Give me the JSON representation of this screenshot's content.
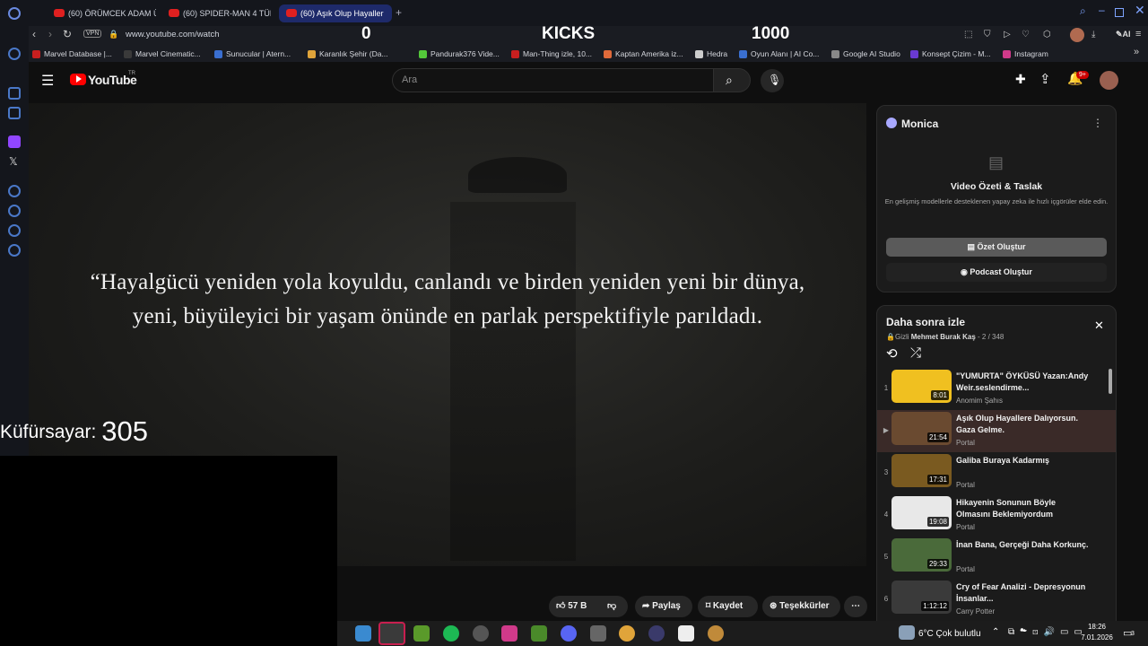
{
  "browser": {
    "tabs": [
      {
        "label": "(60) ÖRÜMCEK ADAM ÜÇ"
      },
      {
        "label": "(60) SPIDER-MAN 4 TÜM"
      },
      {
        "label": "(60) Aşık Olup Hayaller"
      }
    ],
    "url": "www.youtube.com/watch",
    "vpn": "VPN",
    "ai_label": "AI",
    "bookmarks": [
      {
        "label": "Marvel Database |...",
        "color": "#c81f1f"
      },
      {
        "label": "Marvel Cinematic...",
        "color": "#3a3a3a"
      },
      {
        "label": "Sunucular | Atern...",
        "color": "#3a6fd0"
      },
      {
        "label": "Karanlık Şehir (Da...",
        "color": "#e0a43a"
      },
      {
        "label": "Pandurak376 Vide...",
        "color": "#53c83a"
      },
      {
        "label": "Man-Thing izle, 10...",
        "color": "#c81f1f"
      },
      {
        "label": "Kaptan Amerika iz...",
        "color": "#e06a3a"
      },
      {
        "label": "Hedra",
        "color": "#cccccc"
      },
      {
        "label": "Oyun Alanı | AI Co...",
        "color": "#3a6fd0"
      },
      {
        "label": "Google AI Studio",
        "color": "#888888"
      },
      {
        "label": "Konsept Çizim - M...",
        "color": "#6a3ad0"
      },
      {
        "label": "Instagram",
        "color": "#d03a8a"
      }
    ]
  },
  "stream_overlay": {
    "left_count": "0",
    "center_label": "KICKS",
    "right_count": "1000",
    "kufur_label": "Küfürsayar:",
    "kufur_count": "305"
  },
  "youtube": {
    "logo": "YouTube",
    "region": "TR",
    "search_placeholder": "Ara",
    "notif_badge": "9+",
    "quote_line1": "“Hayalgücü yeniden yola koyuldu, canlandı ve birden yeniden yeni bir dünya,",
    "quote_line2": "yeni, büyüleyici bir yaşam önünde en parlak perspektifiyle parıldadı.",
    "actions": {
      "likes": "57 B",
      "share": "Paylaş",
      "save": "Kaydet",
      "thanks": "Teşekkürler"
    }
  },
  "monica": {
    "title": "Monica",
    "heading": "Video Özeti & Taslak",
    "description": "En gelişmiş modellerle desteklenen yapay zeka ile hızlı içgörüler elde edin.",
    "summary_button": "Özet Oluştur",
    "podcast_button": "Podcast Oluştur"
  },
  "playlist": {
    "title": "Daha sonra izle",
    "privacy": "Gizli",
    "owner": "Mehmet Burak Kaş",
    "position": "- 2 / 348",
    "items": [
      {
        "idx": "1",
        "title": "\"YUMURTA\" ÖYKÜSÜ Yazan:Andy Weir.seslendirme...",
        "channel": "Anomim Şahıs",
        "duration": "8:01",
        "thumb": "#f0c020"
      },
      {
        "idx": "▶",
        "title": "Aşık Olup Hayallere Dalıyorsun. Gaza Gelme.",
        "channel": "Portal",
        "duration": "21:54",
        "thumb": "#6a4a30"
      },
      {
        "idx": "3",
        "title": "Galiba Buraya Kadarmış",
        "channel": "Portal",
        "duration": "17:31",
        "thumb": "#7a5a20"
      },
      {
        "idx": "4",
        "title": "Hikayenin Sonunun Böyle Olmasını Beklemiyordum",
        "channel": "Portal",
        "duration": "19:08",
        "thumb": "#e8e8e8"
      },
      {
        "idx": "5",
        "title": "İnan Bana, Gerçeği Daha Korkunç.",
        "channel": "Portal",
        "duration": "29:33",
        "thumb": "#4a6a3a"
      },
      {
        "idx": "6",
        "title": "Cry of Fear Analizi - Depresyonun İnsanlar...",
        "channel": "Carry Potter",
        "duration": "1:12:12",
        "thumb": "#3a3a3a"
      }
    ]
  },
  "taskbar": {
    "weather": "6°C  Çok bulutlu",
    "time": "18:26",
    "date": "7.01.2026",
    "notifications": "3"
  }
}
